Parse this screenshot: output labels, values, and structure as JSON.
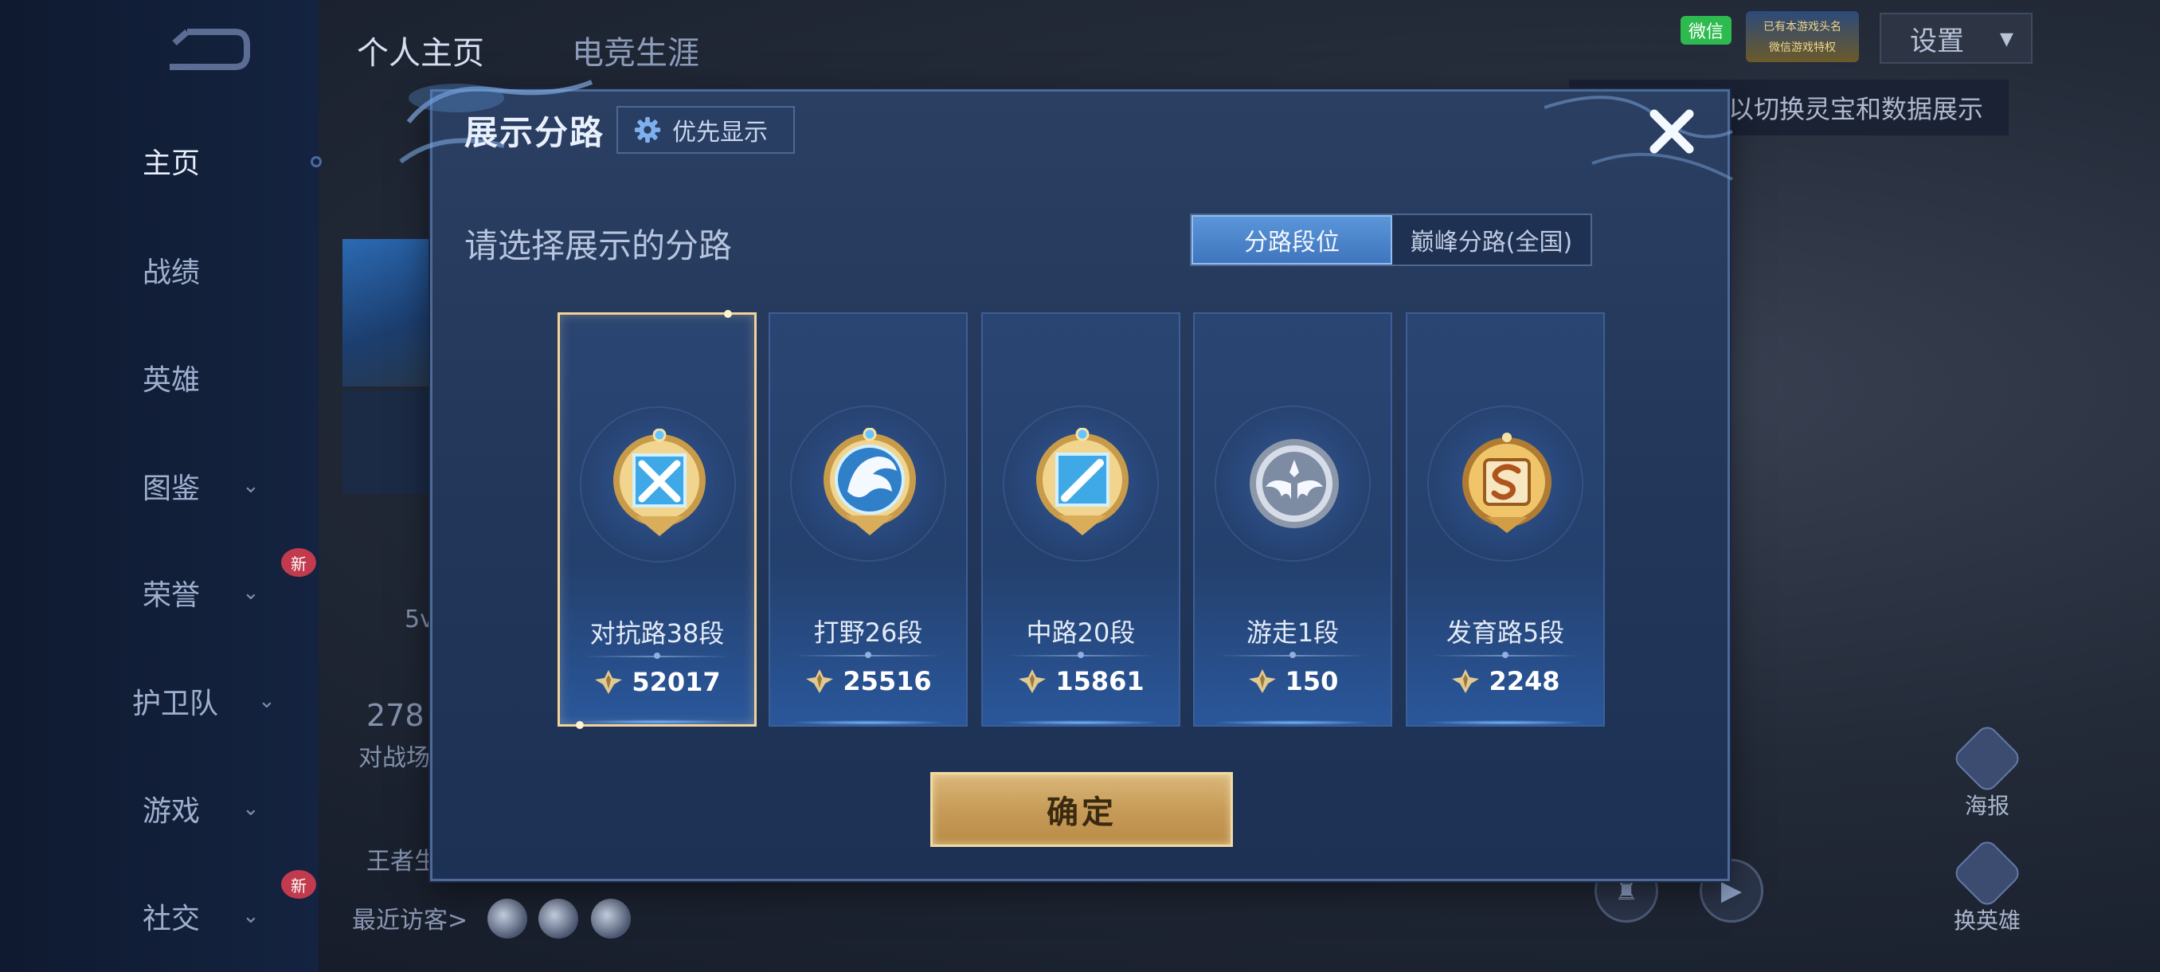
{
  "background": {
    "tabs": [
      "个人主页",
      "电竞生涯"
    ],
    "nav": [
      {
        "label": "主页",
        "has_chevron": false,
        "active": true
      },
      {
        "label": "战绩",
        "has_chevron": false
      },
      {
        "label": "英雄",
        "has_chevron": false
      },
      {
        "label": "图鉴",
        "has_chevron": true
      },
      {
        "label": "荣誉",
        "has_chevron": true,
        "badge": "新"
      },
      {
        "label": "护卫队",
        "has_chevron": true
      },
      {
        "label": "游戏",
        "has_chevron": true
      },
      {
        "label": "社交",
        "has_chevron": true,
        "badge": "新"
      }
    ],
    "chevron": "⌄",
    "partial_texts": [
      "5v",
      "278",
      "对战场",
      "王者生"
    ],
    "visitors_label": "最近访客>",
    "settings_label": "设置",
    "settings_chevron": "▾",
    "wechat_label": "微信",
    "promo_lines": [
      "已有本游戏头名",
      "微信游戏特权"
    ],
    "tooltip": "以切换灵宝和数据展示",
    "side_buttons": [
      "海报",
      "换英雄"
    ]
  },
  "modal": {
    "title": "展示分路",
    "priority_label": "优先显示",
    "subtitle": "请选择展示的分路",
    "toggle_options": [
      "分路段位",
      "巅峰分路(全国)"
    ],
    "toggle_active_index": 0,
    "confirm_label": "确定",
    "selected_index": 0,
    "lanes": [
      {
        "rank": "对抗路38段",
        "score": "52017",
        "icon": "clash-lane-badge-icon"
      },
      {
        "rank": "打野26段",
        "score": "25516",
        "icon": "jungle-badge-icon"
      },
      {
        "rank": "中路20段",
        "score": "15861",
        "icon": "mid-lane-badge-icon"
      },
      {
        "rank": "游走1段",
        "score": "150",
        "icon": "roam-badge-icon"
      },
      {
        "rank": "发育路5段",
        "score": "2248",
        "icon": "farm-lane-badge-icon"
      }
    ],
    "colors": {
      "accent": "#4f88cf",
      "gold": "#d6b26f",
      "selected_border": "#f2d49a"
    }
  }
}
